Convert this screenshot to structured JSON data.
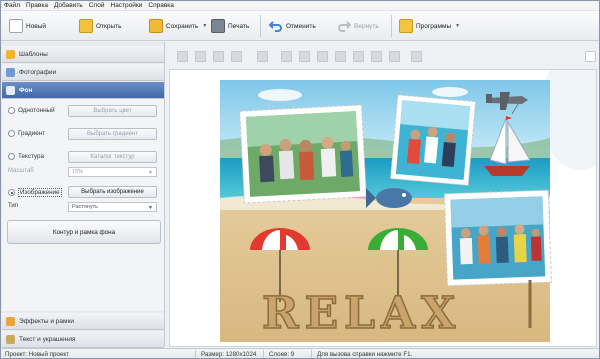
{
  "menu": [
    "Файл",
    "Правка",
    "Добавить",
    "Слой",
    "Настройки",
    "Справка"
  ],
  "toolbar": {
    "new": "Новый",
    "open": "Открыть",
    "save": "Сохранить",
    "print": "Печать",
    "undo": "Отменить",
    "redo": "Вернуть",
    "programs": "Программы"
  },
  "sidebar": {
    "templates": "Шаблоны",
    "photos": "Фотографии",
    "background": "Фон",
    "effects": "Эффекты и рамки",
    "text": "Текст и украшения"
  },
  "background_panel": {
    "solid": "Однотонный",
    "choose_color": "Выбрать цвет",
    "gradient": "Градиент",
    "choose_gradient": "Выбрать градиент",
    "texture": "Текстура",
    "texture_catalog": "Каталог текстур",
    "scale_label": "Масштаб",
    "scale_value": "15%",
    "image": "Изображение",
    "choose_image": "Выбрать изображение",
    "type_label": "Тип",
    "type_value": "Растянуть",
    "contour_button": "Контур и рамка фона"
  },
  "canvas": {
    "relax_text": "RELAX"
  },
  "status": {
    "project": "Проект: Новый проект",
    "size": "Размер: 1280x1024",
    "layers": "Слоев: 9",
    "help": "Для вызова справки нажмите F1."
  },
  "colors": {
    "accent": "#4a6fae",
    "sea": "#2fa8c9",
    "sand": "#e7cf9f"
  }
}
